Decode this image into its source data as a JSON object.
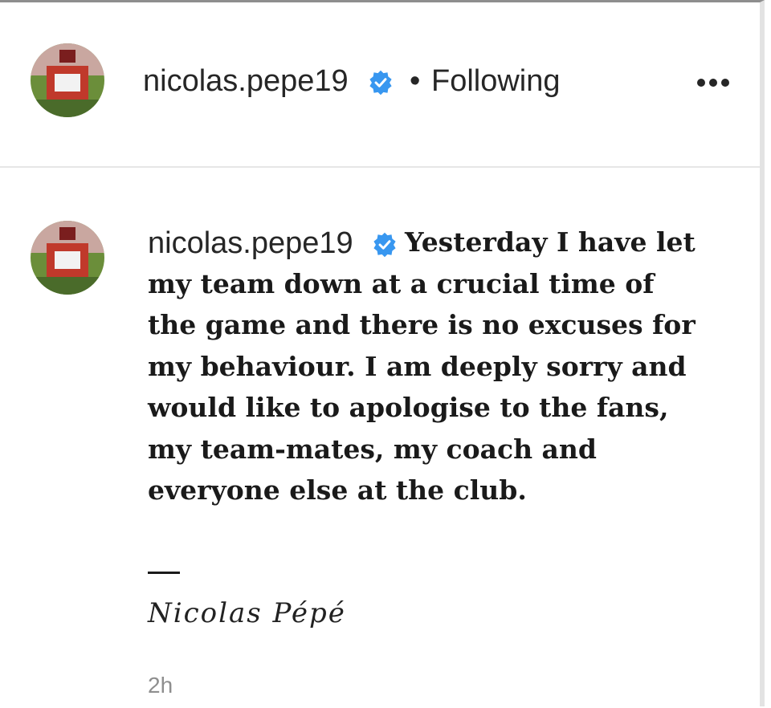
{
  "post_header": {
    "username": "nicolas.pepe19",
    "separator": "•",
    "follow_status": "Following",
    "more_icon": "more-horizontal-icon",
    "verified_icon": "verified-badge-icon"
  },
  "comment": {
    "username": "nicolas.pepe19",
    "text": "Yesterday I have let my team down at a crucial time of the game and there is no excuses for my behaviour. I am deeply sorry and would like to apologise to the fans, my team-mates, my coach and everyone else at the club.",
    "dash": "—",
    "signature": "Nicolas Pépé",
    "timestamp": "2h"
  },
  "colors": {
    "verified_blue": "#3897f0",
    "text": "#262626",
    "muted": "#8e8e8e",
    "divider": "#e6e6e6"
  }
}
